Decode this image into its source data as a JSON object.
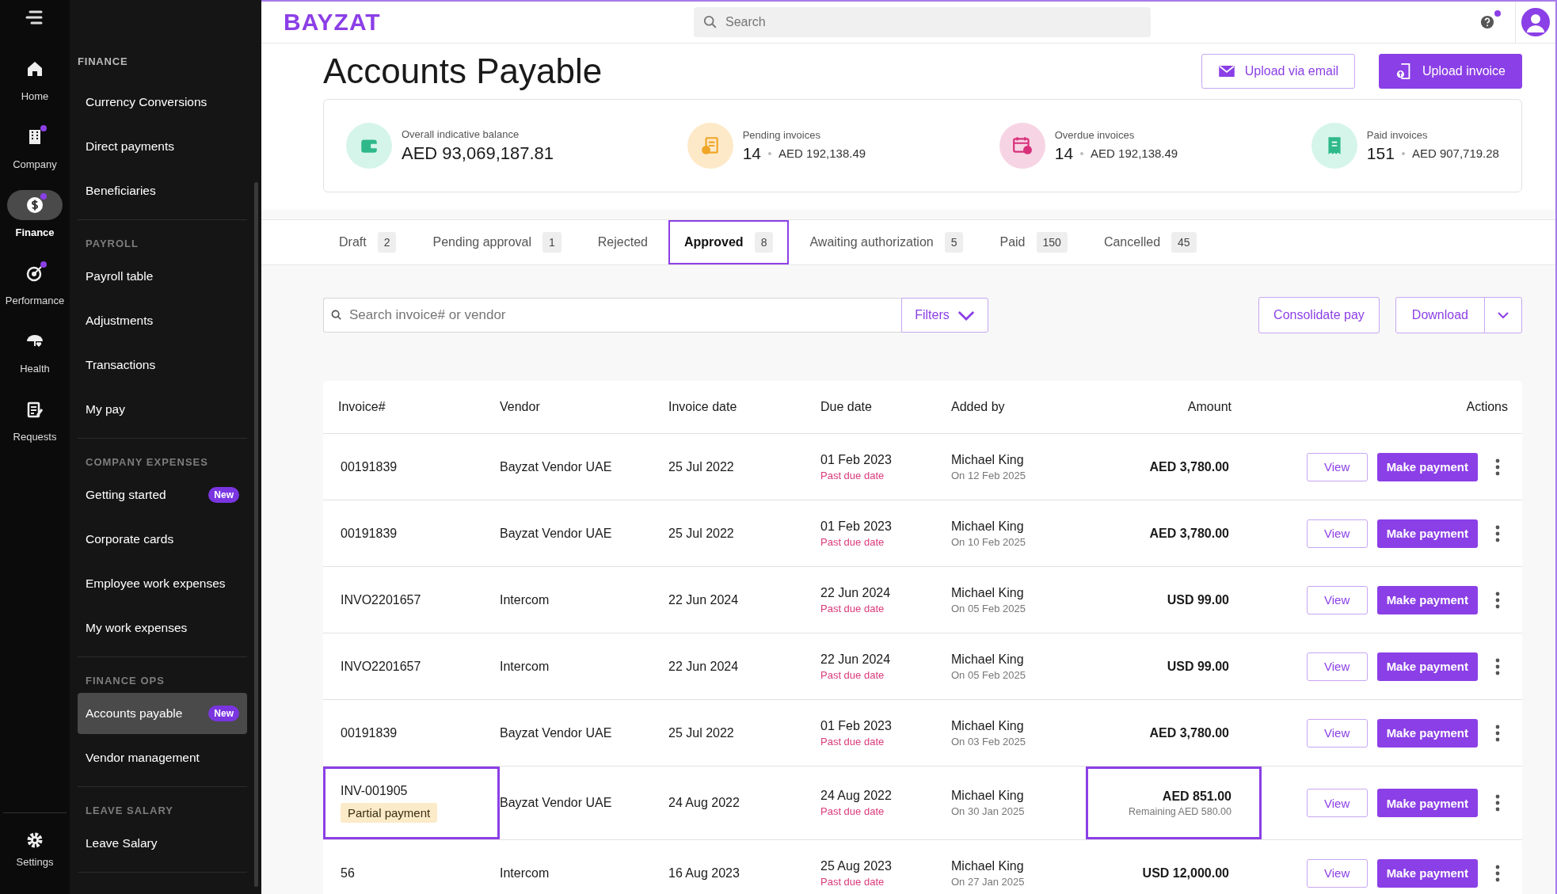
{
  "rail": {
    "items": [
      {
        "label": "Home",
        "selected": false,
        "dot": false
      },
      {
        "label": "Company",
        "selected": false,
        "dot": true
      },
      {
        "label": "Finance",
        "selected": true,
        "dot": true
      },
      {
        "label": "Performance",
        "selected": false,
        "dot": true
      },
      {
        "label": "Health",
        "selected": false,
        "dot": false
      },
      {
        "label": "Requests",
        "selected": false,
        "dot": false
      }
    ],
    "bottom": {
      "label": "Settings"
    }
  },
  "sidebar": {
    "sections": [
      {
        "title": "FINANCE",
        "items": [
          {
            "label": "Currency Conversions",
            "selected": false
          },
          {
            "label": "Direct payments",
            "selected": false
          },
          {
            "label": "Beneficiaries",
            "selected": false
          }
        ]
      },
      {
        "title": "PAYROLL",
        "items": [
          {
            "label": "Payroll table",
            "selected": false
          },
          {
            "label": "Adjustments",
            "selected": false
          },
          {
            "label": "Transactions",
            "selected": false
          },
          {
            "label": "My pay",
            "selected": false
          }
        ]
      },
      {
        "title": "COMPANY EXPENSES",
        "items": [
          {
            "label": "Getting started",
            "badge": "New",
            "selected": false
          },
          {
            "label": "Corporate cards",
            "selected": false
          },
          {
            "label": "Employee work expenses",
            "selected": false
          },
          {
            "label": "My work expenses",
            "selected": false
          }
        ]
      },
      {
        "title": "FINANCE OPS",
        "items": [
          {
            "label": "Accounts payable",
            "badge": "New",
            "selected": true
          },
          {
            "label": "Vendor management",
            "selected": false
          }
        ]
      },
      {
        "title": "LEAVE SALARY",
        "items": [
          {
            "label": "Leave Salary",
            "selected": false
          }
        ]
      }
    ]
  },
  "header": {
    "logo": "BAYZAT",
    "search": {
      "placeholder": "Search"
    },
    "notification_dot": true
  },
  "page": {
    "title": "Accounts Payable",
    "buttons": [
      {
        "label": "Upload via email",
        "kind": "secondary"
      },
      {
        "label": "Upload invoice",
        "kind": "primary"
      }
    ]
  },
  "stats": [
    {
      "kind": "balance",
      "color": "#d6f5ea",
      "label": "Overall indicative balance",
      "value": "AED 93,069,187.81"
    },
    {
      "kind": "count",
      "color": "#fde9c8",
      "label": "Pending invoices",
      "count": "14",
      "value": "AED 192,138.49"
    },
    {
      "kind": "count",
      "color": "#f7d4e4",
      "label": "Overdue invoices",
      "count": "14",
      "value": "AED 192,138.49"
    },
    {
      "kind": "count",
      "color": "#d6f5ea",
      "label": "Paid invoices",
      "count": "151",
      "value": "AED 907,719.28"
    }
  ],
  "tabs": [
    {
      "label": "Draft",
      "count": "2",
      "selected": false
    },
    {
      "label": "Pending approval",
      "count": "1",
      "selected": false
    },
    {
      "label": "Rejected",
      "selected": false
    },
    {
      "label": "Approved",
      "count": "8",
      "selected": true
    },
    {
      "label": "Awaiting authorization",
      "count": "5",
      "selected": false
    },
    {
      "label": "Paid",
      "count": "150",
      "selected": false
    },
    {
      "label": "Cancelled",
      "count": "45",
      "selected": false
    }
  ],
  "toolbar": {
    "search": {
      "placeholder": "Search invoice# or vendor"
    },
    "filters": "Filters",
    "consolidate": "Consolidate pay",
    "download": "Download"
  },
  "table": {
    "columns": [
      "Invoice#",
      "Vendor",
      "Invoice date",
      "Due date",
      "Added by",
      "Amount",
      "Actions"
    ],
    "rows": [
      {
        "invoice": "00191839",
        "vendor": "Bayzat Vendor UAE",
        "invoice_date": "25 Jul 2022",
        "due_date": "01 Feb 2023",
        "due_note": "Past due date",
        "added_by": "Michael King",
        "added_on": "On 12 Feb 2025",
        "amount": "AED 3,780.00",
        "highlighted": false,
        "view": "View",
        "pay": "Make payment"
      },
      {
        "invoice": "00191839",
        "vendor": "Bayzat Vendor UAE",
        "invoice_date": "25 Jul 2022",
        "due_date": "01 Feb 2023",
        "due_note": "Past due date",
        "added_by": "Michael King",
        "added_on": "On 10 Feb 2025",
        "amount": "AED 3,780.00",
        "highlighted": false,
        "view": "View",
        "pay": "Make payment"
      },
      {
        "invoice": "INVO2201657",
        "vendor": "Intercom",
        "invoice_date": "22 Jun 2024",
        "due_date": "22 Jun 2024",
        "due_note": "Past due date",
        "added_by": "Michael King",
        "added_on": "On 05 Feb 2025",
        "amount": "USD 99.00",
        "highlighted": false,
        "view": "View",
        "pay": "Make payment"
      },
      {
        "invoice": "INVO2201657",
        "vendor": "Intercom",
        "invoice_date": "22 Jun 2024",
        "due_date": "22 Jun 2024",
        "due_note": "Past due date",
        "added_by": "Michael King",
        "added_on": "On 05 Feb 2025",
        "amount": "USD 99.00",
        "highlighted": false,
        "view": "View",
        "pay": "Make payment"
      },
      {
        "invoice": "00191839",
        "vendor": "Bayzat Vendor UAE",
        "invoice_date": "25 Jul 2022",
        "due_date": "01 Feb 2023",
        "due_note": "Past due date",
        "added_by": "Michael King",
        "added_on": "On 03 Feb 2025",
        "amount": "AED 3,780.00",
        "highlighted": false,
        "view": "View",
        "pay": "Make payment"
      },
      {
        "invoice": "INV-001905",
        "status": "Partial payment",
        "vendor": "Bayzat Vendor UAE",
        "invoice_date": "24 Aug 2022",
        "due_date": "24 Aug 2022",
        "due_note": "Past due date",
        "added_by": "Michael King",
        "added_on": "On 30 Jan 2025",
        "amount": "AED 851.00",
        "remaining": "Remaining AED 580.00",
        "highlighted": true,
        "view": "View",
        "pay": "Make payment"
      },
      {
        "invoice": "56",
        "vendor": "Intercom",
        "invoice_date": "16 Aug 2023",
        "due_date": "25 Aug 2023",
        "due_note": "Past due date",
        "added_by": "Michael King",
        "added_on": "On 27 Jan 2025",
        "amount": "USD 12,000.00",
        "highlighted": false,
        "view": "View",
        "pay": "Make payment"
      }
    ]
  }
}
